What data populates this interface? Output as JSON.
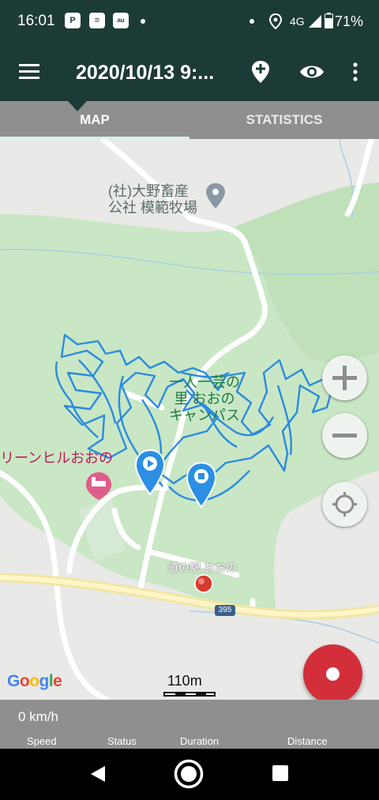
{
  "status_bar": {
    "time": "16:01",
    "network": "4G",
    "battery": "71%",
    "icons": [
      "paypay-icon",
      "news-icon",
      "au-pay-icon",
      "location-icon",
      "signal-icon",
      "battery-icon"
    ]
  },
  "app_bar": {
    "title": "2020/10/13 9:...",
    "icons": [
      "menu-icon",
      "add-marker-icon",
      "visibility-icon",
      "more-vert-icon"
    ]
  },
  "tabs": [
    {
      "label": "MAP",
      "selected": true
    },
    {
      "label": "STATISTICS",
      "selected": false
    }
  ],
  "map": {
    "poi": {
      "line1": "(社)大野畜産",
      "line2": "公社 模範牧場"
    },
    "campus": {
      "line1": "一人一芸の",
      "line2": "里 おおの",
      "line3": "キャンパス"
    },
    "hotel": "リーンヒルおおの",
    "road_station": "道の駅 おおの",
    "route_number": "395",
    "attribution": "Google",
    "scale": "110m",
    "colors": {
      "track": "#2a8be0",
      "marker": "#2b8fe3",
      "accent": "#d32f3a",
      "header": "#1d3b36",
      "panel": "#8f8f8f"
    }
  },
  "controls": {
    "zoom_in": "+",
    "zoom_out": "−"
  },
  "stats": {
    "speed_value": "0 km/h",
    "labels": {
      "speed": "Speed",
      "status": "Status",
      "duration": "Duration",
      "distance": "Distance"
    }
  }
}
